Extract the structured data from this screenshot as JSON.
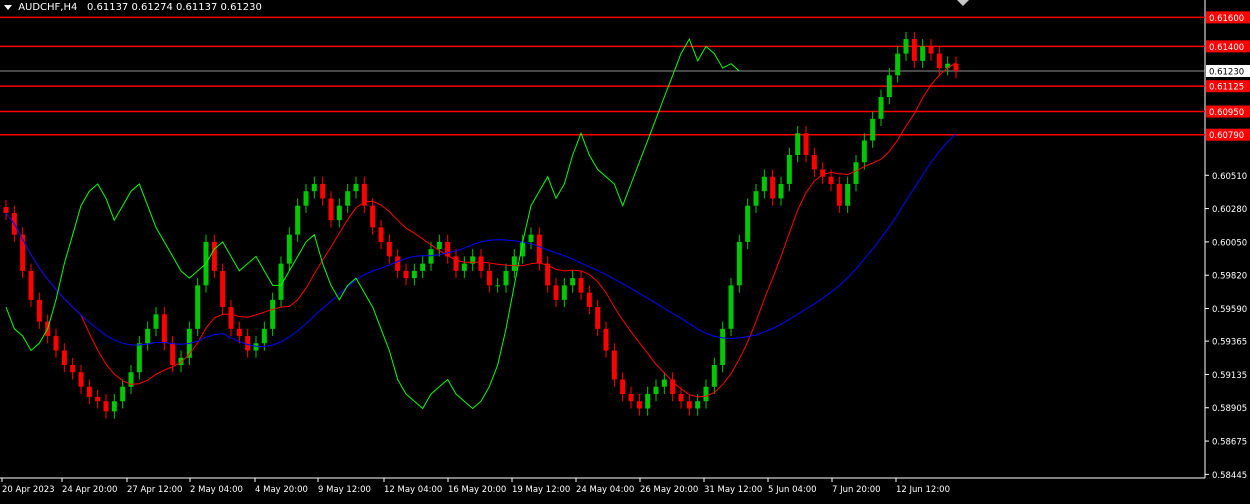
{
  "header": {
    "symbol": "AUDCHF,H4",
    "ohlc": "0.61137 0.61274 0.61137 0.61230"
  },
  "colors": {
    "background": "#000000",
    "axis": "#ffffff",
    "bull_candle": "#00c800",
    "bear_candle": "#ff0000",
    "tenkan": "#ff0000",
    "kijun": "#0000ff",
    "chikou": "#00ff00",
    "kumo": "#f5c6a6",
    "level_line": "#ff0000",
    "bid_line": "#c0c0c0"
  },
  "chart_data": {
    "type": "line",
    "title": "AUDCHF,H4",
    "ylim": [
      0.5842,
      0.6172
    ],
    "y_ticks": [
      "0.61600",
      "0.61400",
      "0.61230",
      "0.61125",
      "0.60950",
      "0.60790",
      "0.60510",
      "0.60280",
      "0.60050",
      "0.59820",
      "0.59590",
      "0.59365",
      "0.59135",
      "0.58905",
      "0.58675",
      "0.58445"
    ],
    "x_ticks": [
      "20 Apr 2023",
      "24 Apr 20:00",
      "27 Apr 12:00",
      "2 May 04:00",
      "4 May 20:00",
      "9 May 12:00",
      "12 May 04:00",
      "16 May 20:00",
      "19 May 12:00",
      "24 May 04:00",
      "26 May 20:00",
      "31 May 12:00",
      "5 Jun 04:00",
      "7 Jun 20:00",
      "12 Jun 12:00"
    ],
    "levels": [
      {
        "label": "0.61600",
        "value": 0.616
      },
      {
        "label": "0.61400",
        "value": 0.614
      },
      {
        "label": "0.61125",
        "value": 0.61125
      },
      {
        "label": "0.60950",
        "value": 0.6095
      },
      {
        "label": "0.60790",
        "value": 0.6079
      }
    ],
    "current_price": {
      "label": "0.61230",
      "value": 0.6123
    },
    "close": [
      0.6025,
      0.601,
      0.5985,
      0.5965,
      0.595,
      0.594,
      0.593,
      0.592,
      0.5915,
      0.5905,
      0.5898,
      0.5895,
      0.5888,
      0.5895,
      0.5905,
      0.5915,
      0.5935,
      0.5945,
      0.5955,
      0.5935,
      0.592,
      0.5925,
      0.5945,
      0.5975,
      0.6005,
      0.5985,
      0.596,
      0.5945,
      0.594,
      0.593,
      0.5935,
      0.5945,
      0.5965,
      0.599,
      0.601,
      0.603,
      0.604,
      0.6045,
      0.6035,
      0.602,
      0.603,
      0.604,
      0.6045,
      0.603,
      0.6015,
      0.6005,
      0.5995,
      0.5985,
      0.598,
      0.5985,
      0.599,
      0.6,
      0.6005,
      0.5995,
      0.5985,
      0.599,
      0.5995,
      0.5985,
      0.5975,
      0.5975,
      0.5985,
      0.5995,
      0.6005,
      0.601,
      0.599,
      0.5975,
      0.5965,
      0.5975,
      0.598,
      0.597,
      0.596,
      0.5945,
      0.593,
      0.591,
      0.59,
      0.5895,
      0.589,
      0.59,
      0.5905,
      0.591,
      0.59,
      0.5895,
      0.589,
      0.5895,
      0.5905,
      0.592,
      0.5945,
      0.5975,
      0.6005,
      0.603,
      0.604,
      0.605,
      0.6035,
      0.6045,
      0.6065,
      0.608,
      0.6065,
      0.6055,
      0.605,
      0.6045,
      0.603,
      0.6045,
      0.606,
      0.6075,
      0.609,
      0.6105,
      0.612,
      0.6135,
      0.6145,
      0.613,
      0.614,
      0.6135,
      0.6125,
      0.6128,
      0.6123
    ]
  }
}
